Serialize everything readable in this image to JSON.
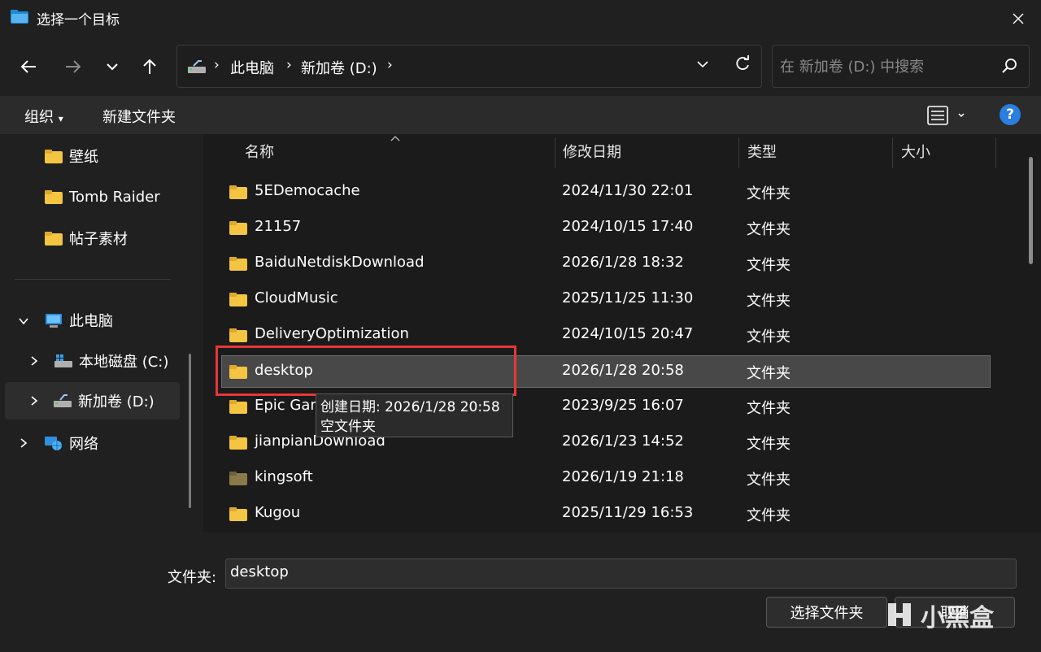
{
  "window": {
    "title": "选择一个目标",
    "close_glyph": "✕"
  },
  "toolbar": {
    "back_glyph": "←",
    "forward_glyph": "→",
    "recent_glyph": "⌄",
    "up_glyph": "↑"
  },
  "address": {
    "crumbs": [
      "此电脑",
      "新加卷 (D:)"
    ],
    "separator": "›",
    "refresh_glyph": "↻"
  },
  "search": {
    "placeholder": "在 新加卷 (D:) 中搜索"
  },
  "commands": {
    "organize": "组织",
    "organize_caret": "▾",
    "new_folder": "新建文件夹",
    "help": "?"
  },
  "nav": {
    "quick": [
      {
        "label": "壁纸"
      },
      {
        "label": "Tomb Raider"
      },
      {
        "label": "帖子素材"
      }
    ],
    "this_pc": "此电脑",
    "drives": [
      {
        "label": "本地磁盘 (C:)"
      },
      {
        "label": "新加卷 (D:)",
        "selected": true
      }
    ],
    "network": "网络"
  },
  "columns": {
    "name": "名称",
    "date": "修改日期",
    "type": "类型",
    "size": "大小"
  },
  "files": [
    {
      "name": "5EDemocache",
      "date": "2024/11/30 22:01",
      "type": "文件夹"
    },
    {
      "name": "21157",
      "date": "2024/10/15 17:40",
      "type": "文件夹"
    },
    {
      "name": "BaiduNetdiskDownload",
      "date": "2026/1/28 18:32",
      "type": "文件夹"
    },
    {
      "name": "CloudMusic",
      "date": "2025/11/25 11:30",
      "type": "文件夹"
    },
    {
      "name": "DeliveryOptimization",
      "date": "2024/10/15 20:47",
      "type": "文件夹"
    },
    {
      "name": "desktop",
      "date": "2026/1/28 20:58",
      "type": "文件夹",
      "selected": true
    },
    {
      "name": "Epic Games",
      "date": "2023/9/25 16:07",
      "type": "文件夹"
    },
    {
      "name": "jianpianDownload",
      "date": "2026/1/23 14:52",
      "type": "文件夹"
    },
    {
      "name": "kingsoft",
      "date": "2026/1/19 21:18",
      "type": "文件夹"
    },
    {
      "name": "Kugou",
      "date": "2025/11/29 16:53",
      "type": "文件夹"
    }
  ],
  "tooltip": {
    "line1": "创建日期: 2026/1/28 20:58",
    "line2": "空文件夹"
  },
  "bottom": {
    "folder_label": "文件夹:",
    "folder_value": "desktop",
    "select_button": "选择文件夹",
    "cancel_button": "取消"
  },
  "watermark": "小黑盒",
  "colors": {
    "folder": "#f4c542",
    "folder_dark": "#8a7a4a",
    "accent": "#2a7de1",
    "highlight_box": "#e53935"
  }
}
